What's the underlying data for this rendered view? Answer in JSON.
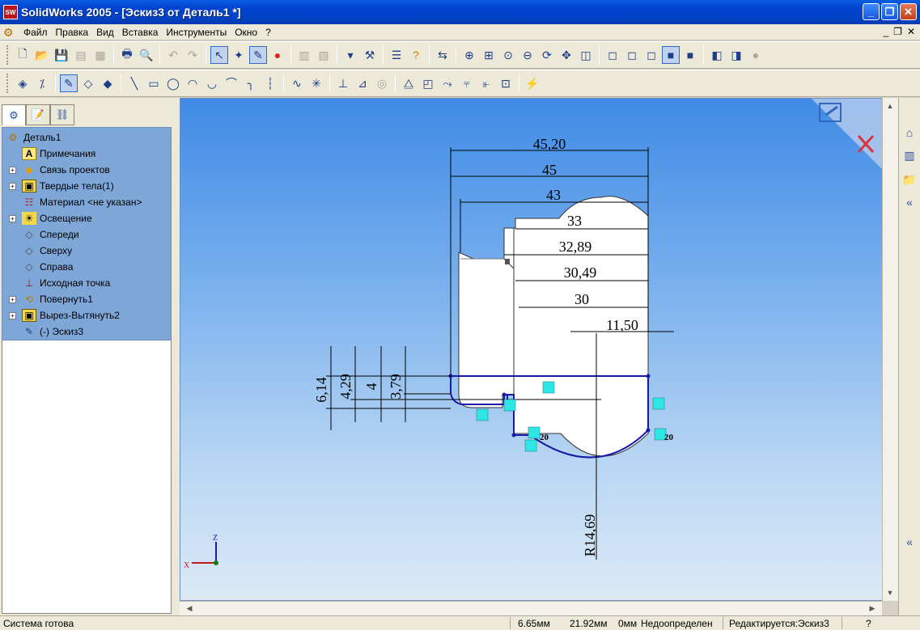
{
  "window": {
    "title": "SolidWorks 2005 - [Эскиз3 от Деталь1 *]",
    "app_icon_label": "SW"
  },
  "menu": {
    "items": [
      "Файл",
      "Правка",
      "Вид",
      "Вставка",
      "Инструменты",
      "Окно",
      "?"
    ]
  },
  "feature_tree": {
    "root": "Деталь1",
    "items": [
      {
        "label": "Примечания",
        "icon": "annotations-icon",
        "expandable": false
      },
      {
        "label": "Связь проектов",
        "icon": "design-binder-icon",
        "expandable": true
      },
      {
        "label": "Твердые тела(1)",
        "icon": "solid-bodies-icon",
        "expandable": true
      },
      {
        "label": "Материал <не указан>",
        "icon": "material-icon",
        "expandable": false
      },
      {
        "label": "Освещение",
        "icon": "lighting-icon",
        "expandable": true
      },
      {
        "label": "Спереди",
        "icon": "plane-icon",
        "expandable": false
      },
      {
        "label": "Сверху",
        "icon": "plane-icon",
        "expandable": false
      },
      {
        "label": "Справа",
        "icon": "plane-icon",
        "expandable": false
      },
      {
        "label": "Исходная точка",
        "icon": "origin-icon",
        "expandable": false
      },
      {
        "label": "Повернуть1",
        "icon": "revolve-icon",
        "expandable": true
      },
      {
        "label": "Вырез-Вытянуть2",
        "icon": "cut-extrude-icon",
        "expandable": true
      },
      {
        "label": "(-) Эскиз3",
        "icon": "sketch-icon",
        "expandable": false
      }
    ]
  },
  "sketch": {
    "horizontal_dims": [
      "45,20",
      "45",
      "43",
      "33",
      "32,89",
      "30,49",
      "30",
      "11,50"
    ],
    "vertical_dims": [
      "6,14",
      "4,29",
      "4",
      "3,79"
    ],
    "radius_dim": "R14,69",
    "relation_labels": [
      "20",
      "20"
    ],
    "axis_labels": {
      "z": "Z",
      "x": "X"
    },
    "colors": {
      "sketch": "#1a1aa8",
      "dimension": "#000000",
      "relation": "#2fe6e6",
      "cancel": "#d8343c"
    }
  },
  "status": {
    "message": "Система готова",
    "x": "6.65мм",
    "y": "21.92мм",
    "z": "0мм",
    "state": "Недоопределен",
    "editing": "Редактируется:Эскиз3"
  }
}
